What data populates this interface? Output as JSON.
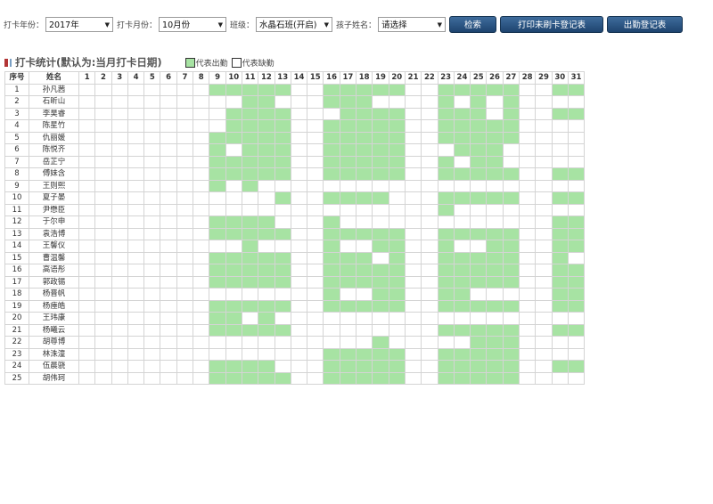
{
  "filters": {
    "year_label": "打卡年份：",
    "year_value": "2017年",
    "month_label": "打卡月份：",
    "month_value": "10月份",
    "class_label": "班级：",
    "class_value": "水晶石班(开启)",
    "child_label": "孩子姓名：",
    "child_value": "请选择",
    "dropdown_icon": "triangle-down",
    "search_button": "检索",
    "print_button": "打印未刷卡登记表",
    "attendance_button": "出勤登记表"
  },
  "stats": {
    "title": "打卡统计(默认为:当月打卡日期)",
    "legend_present": "代表出勤",
    "legend_absent": "代表缺勤"
  },
  "colors": {
    "present": "#a7e3a3",
    "absent": "#ffffff",
    "button": "#2a5282"
  },
  "table": {
    "header_index": "序号",
    "header_name": "姓名",
    "days": [
      "1",
      "2",
      "3",
      "4",
      "5",
      "6",
      "7",
      "8",
      "9",
      "10",
      "11",
      "12",
      "13",
      "14",
      "15",
      "16",
      "17",
      "18",
      "19",
      "20",
      "21",
      "22",
      "23",
      "24",
      "25",
      "26",
      "27",
      "28",
      "29",
      "30",
      "31"
    ],
    "rows": [
      {
        "index": "1",
        "name": "孙凡茜",
        "present": [
          9,
          10,
          11,
          12,
          13,
          16,
          17,
          18,
          19,
          20,
          23,
          24,
          25,
          26,
          27,
          30,
          31
        ]
      },
      {
        "index": "2",
        "name": "石昕山",
        "present": [
          11,
          12,
          16,
          17,
          18,
          23,
          25,
          27
        ]
      },
      {
        "index": "3",
        "name": "李昊睿",
        "present": [
          10,
          11,
          12,
          13,
          17,
          18,
          19,
          20,
          23,
          24,
          25,
          27,
          30,
          31
        ]
      },
      {
        "index": "4",
        "name": "陈星竹",
        "present": [
          10,
          11,
          12,
          13,
          16,
          17,
          18,
          19,
          20,
          23,
          24,
          25,
          26,
          27
        ]
      },
      {
        "index": "5",
        "name": "仇丽媛",
        "present": [
          9,
          10,
          11,
          12,
          13,
          16,
          17,
          18,
          19,
          20,
          23,
          24,
          25,
          26,
          27
        ]
      },
      {
        "index": "6",
        "name": "陈悦齐",
        "present": [
          9,
          11,
          12,
          13,
          16,
          17,
          18,
          19,
          20,
          24,
          25,
          26
        ]
      },
      {
        "index": "7",
        "name": "岳芷宁",
        "present": [
          9,
          10,
          11,
          12,
          13,
          16,
          17,
          18,
          19,
          20,
          23,
          25,
          26
        ]
      },
      {
        "index": "8",
        "name": "傅妹含",
        "present": [
          9,
          10,
          11,
          12,
          13,
          16,
          17,
          18,
          19,
          20,
          23,
          24,
          25,
          26,
          27,
          30,
          31
        ]
      },
      {
        "index": "9",
        "name": "王则熙",
        "present": [
          9,
          11
        ]
      },
      {
        "index": "10",
        "name": "夏子晏",
        "present": [
          13,
          16,
          17,
          18,
          19,
          23,
          24,
          25,
          26,
          27,
          30,
          31
        ]
      },
      {
        "index": "11",
        "name": "尹懋臣",
        "present": [
          23
        ]
      },
      {
        "index": "12",
        "name": "于尔申",
        "present": [
          9,
          10,
          11,
          12,
          16,
          30,
          31
        ]
      },
      {
        "index": "13",
        "name": "袁浩博",
        "present": [
          9,
          10,
          11,
          12,
          13,
          16,
          17,
          18,
          19,
          20,
          23,
          24,
          25,
          26,
          27,
          30,
          31
        ]
      },
      {
        "index": "14",
        "name": "王馨仪",
        "present": [
          11,
          16,
          19,
          20,
          23,
          26,
          27,
          30,
          31
        ]
      },
      {
        "index": "15",
        "name": "曹温馨",
        "present": [
          9,
          10,
          11,
          12,
          13,
          16,
          17,
          18,
          20,
          23,
          24,
          25,
          26,
          27,
          30
        ]
      },
      {
        "index": "16",
        "name": "高语彤",
        "present": [
          9,
          10,
          11,
          12,
          13,
          16,
          17,
          18,
          19,
          20,
          23,
          24,
          25,
          26,
          27,
          30,
          31
        ]
      },
      {
        "index": "17",
        "name": "郭政锡",
        "present": [
          9,
          10,
          11,
          12,
          13,
          16,
          17,
          18,
          19,
          20,
          23,
          24,
          25,
          26,
          27,
          30,
          31
        ]
      },
      {
        "index": "18",
        "name": "杨晋帆",
        "present": [
          16,
          19,
          20,
          23,
          24,
          30,
          31
        ]
      },
      {
        "index": "19",
        "name": "杨瘗皓",
        "present": [
          9,
          10,
          11,
          12,
          13,
          16,
          17,
          18,
          19,
          20,
          23,
          24,
          25,
          26,
          27,
          30,
          31
        ]
      },
      {
        "index": "20",
        "name": "王玮康",
        "present": [
          9,
          10,
          12
        ]
      },
      {
        "index": "21",
        "name": "杨曦云",
        "present": [
          9,
          10,
          11,
          12,
          13,
          23,
          24,
          25,
          26,
          27,
          30,
          31
        ]
      },
      {
        "index": "22",
        "name": "胡尊博",
        "present": [
          19,
          25,
          26,
          27
        ]
      },
      {
        "index": "23",
        "name": "林洙潼",
        "present": [
          16,
          17,
          18,
          19,
          20,
          23,
          24,
          25,
          26,
          27
        ]
      },
      {
        "index": "24",
        "name": "伍晨骁",
        "present": [
          9,
          10,
          11,
          12,
          16,
          17,
          18,
          19,
          20,
          23,
          24,
          25,
          26,
          27,
          30,
          31
        ]
      },
      {
        "index": "25",
        "name": "胡伟珂",
        "present": [
          9,
          10,
          11,
          12,
          13,
          16,
          17,
          18,
          19,
          20,
          23,
          24,
          25,
          26,
          27
        ]
      }
    ]
  }
}
